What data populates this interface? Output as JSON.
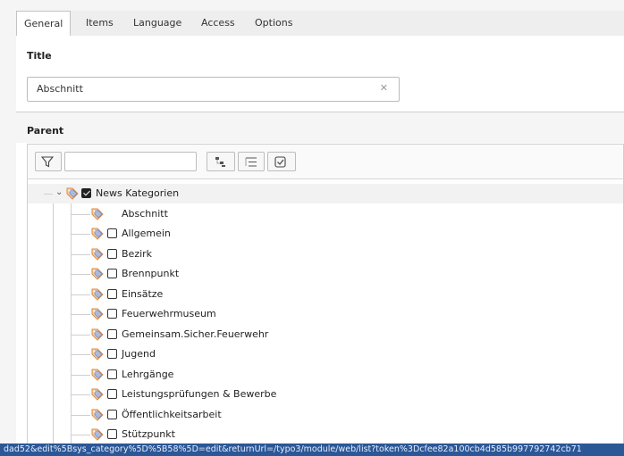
{
  "tabs": [
    {
      "label": "General",
      "active": true
    },
    {
      "label": "Items",
      "active": false
    },
    {
      "label": "Language",
      "active": false
    },
    {
      "label": "Access",
      "active": false
    },
    {
      "label": "Options",
      "active": false
    }
  ],
  "title_section": {
    "label": "Title",
    "value": "Abschnitt",
    "clear_icon": "close-icon"
  },
  "parent_section": {
    "label": "Parent",
    "filter_placeholder": "",
    "toolbar_icons": [
      "filter-icon",
      "expand-tree-icon",
      "collapse-tree-icon",
      "show-selected-icon"
    ]
  },
  "tree": {
    "root": {
      "label": "News Kategorien",
      "checked": true
    },
    "children": [
      {
        "label": "Abschnitt",
        "has_checkbox": false
      },
      {
        "label": "Allgemein",
        "has_checkbox": true
      },
      {
        "label": "Bezirk",
        "has_checkbox": true
      },
      {
        "label": "Brennpunkt",
        "has_checkbox": true
      },
      {
        "label": "Einsätze",
        "has_checkbox": true
      },
      {
        "label": "Feuerwehrmuseum",
        "has_checkbox": true
      },
      {
        "label": "Gemeinsam.Sicher.Feuerwehr",
        "has_checkbox": true
      },
      {
        "label": "Jugend",
        "has_checkbox": true
      },
      {
        "label": "Lehrgänge",
        "has_checkbox": true
      },
      {
        "label": "Leistungsprüfungen & Bewerbe",
        "has_checkbox": true
      },
      {
        "label": "Öffentlichkeitsarbeit",
        "has_checkbox": true
      },
      {
        "label": "Stützpunkt",
        "has_checkbox": true
      }
    ]
  },
  "status_bar": {
    "url": "dad52&edit%5Bsys_category%5D%5B58%5D=edit&returnUrl=/typo3/module/web/list?token%3Dcfee82a100cb4d585b997792742cb71"
  },
  "colors": {
    "status_bar_bg": "#2b5797",
    "tag_icon_orange": "#f0a35a",
    "tag_icon_blue": "#6a8fd6"
  }
}
